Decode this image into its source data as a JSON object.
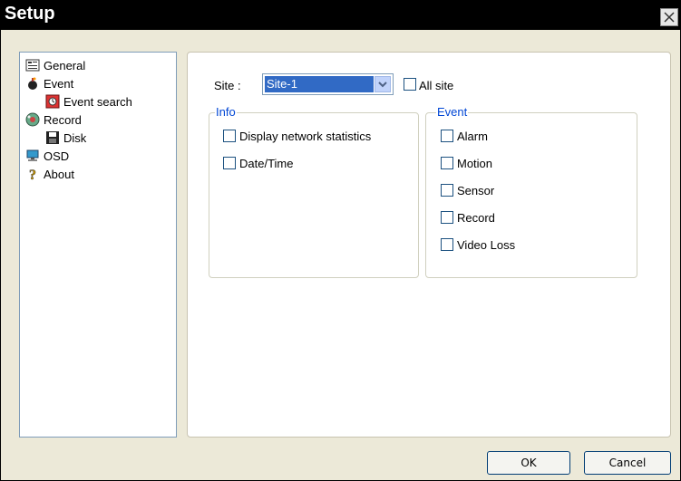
{
  "window": {
    "title": "Setup"
  },
  "tree": [
    {
      "label": "General",
      "icon": "general-icon"
    },
    {
      "label": "Event",
      "icon": "event-icon"
    },
    {
      "label": "Event search",
      "icon": "event-search-icon"
    },
    {
      "label": "Record",
      "icon": "record-icon"
    },
    {
      "label": "Disk",
      "icon": "disk-icon"
    },
    {
      "label": "OSD",
      "icon": "osd-icon"
    },
    {
      "label": "About",
      "icon": "about-icon"
    }
  ],
  "site": {
    "label": "Site :",
    "selected": "Site-1",
    "all_site_label": "All site"
  },
  "info": {
    "title": "Info",
    "items": [
      "Display network statistics",
      "Date/Time"
    ]
  },
  "event": {
    "title": "Event",
    "items": [
      "Alarm",
      "Motion",
      "Sensor",
      "Record",
      "Video Loss"
    ]
  },
  "buttons": {
    "ok": "OK",
    "cancel": "Cancel"
  },
  "colors": {
    "titlebar": "#000000",
    "selection": "#316ac5",
    "group_title": "#0046d5"
  }
}
